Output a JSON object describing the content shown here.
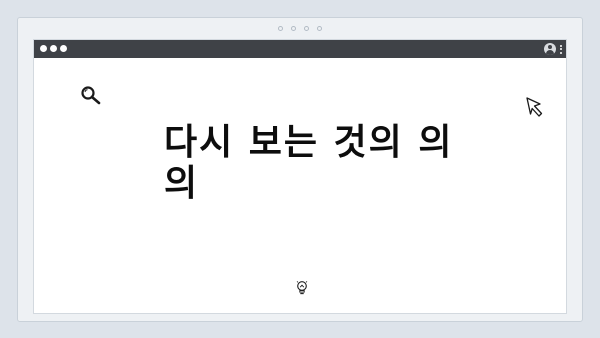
{
  "window": {
    "controls": [
      "dot",
      "dot",
      "dot"
    ],
    "titlebar_color": "#3f4247"
  },
  "pager": {
    "dots": 4
  },
  "icons": {
    "top_left": "search-icon",
    "top_right": "cursor-icon",
    "bottom": "lightbulb-icon",
    "titlebar_user": "user-icon",
    "titlebar_menu": "kebab-menu-icon"
  },
  "content": {
    "heading": "다시 보는 것의 의의"
  },
  "colors": {
    "background": "#dde3ea",
    "frame": "#eef1f4",
    "canvas": "#ffffff",
    "text": "#0d0d0d"
  }
}
